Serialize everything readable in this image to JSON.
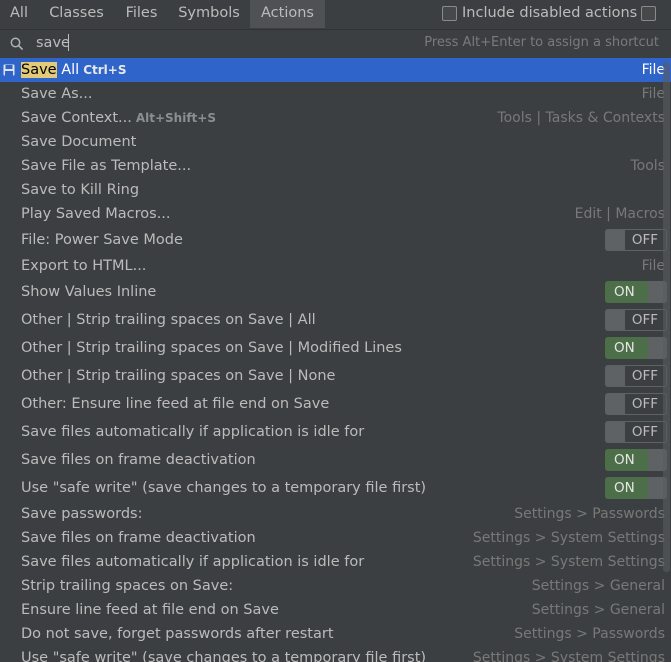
{
  "tabs": [
    {
      "label": "All",
      "active": false
    },
    {
      "label": "Classes",
      "active": false
    },
    {
      "label": "Files",
      "active": false
    },
    {
      "label": "Symbols",
      "active": false
    },
    {
      "label": "Actions",
      "active": true
    }
  ],
  "include_disabled": {
    "label": "Include disabled actions",
    "checked": false
  },
  "search": {
    "value": "save",
    "hint": "Press Alt+Enter to assign a shortcut"
  },
  "rows": [
    {
      "pre": "",
      "hl": "Save",
      "post": " All",
      "kbd": "Ctrl+S",
      "loc": "File",
      "selected": true,
      "icon": "save-icon"
    },
    {
      "pre": "Save As...",
      "loc": "File"
    },
    {
      "pre": "Save Context...",
      "kbd": "Alt+Shift+S",
      "loc": "Tools | Tasks & Contexts"
    },
    {
      "pre": "Save Document",
      "loc": ""
    },
    {
      "pre": "Save File as Template...",
      "loc": "Tools"
    },
    {
      "pre": "Save to Kill Ring",
      "loc": ""
    },
    {
      "pre": "Play Saved Macros...",
      "loc": "Edit | Macros"
    },
    {
      "pre": "File: Power Save Mode",
      "toggle": "OFF"
    },
    {
      "pre": "Export to HTML...",
      "loc": "File"
    },
    {
      "pre": "Show Values Inline",
      "toggle": "ON"
    },
    {
      "pre": "Other | Strip trailing spaces on Save | All",
      "toggle": "OFF"
    },
    {
      "pre": "Other | Strip trailing spaces on Save | Modified Lines",
      "toggle": "ON"
    },
    {
      "pre": "Other | Strip trailing spaces on Save | None",
      "toggle": "OFF"
    },
    {
      "pre": "Other: Ensure line feed at file end on Save",
      "toggle": "OFF"
    },
    {
      "pre": "Save files automatically if application is idle for",
      "toggle": "OFF"
    },
    {
      "pre": "Save files on frame deactivation",
      "toggle": "ON"
    },
    {
      "pre": "Use \"safe write\" (save changes to a temporary file first)",
      "toggle": "ON"
    },
    {
      "pre": "Save passwords:",
      "loc": "Settings > Passwords"
    },
    {
      "pre": "Save files on frame deactivation",
      "loc": "Settings > System Settings"
    },
    {
      "pre": "Save files automatically if application is idle for",
      "loc": "Settings > System Settings"
    },
    {
      "pre": "Strip trailing spaces on Save:",
      "loc": "Settings > General"
    },
    {
      "pre": "Ensure line feed at file end on Save",
      "loc": "Settings > General"
    },
    {
      "pre": "Do not save, forget passwords after restart",
      "loc": "Settings > Passwords"
    },
    {
      "pre": "Use \"safe write\" (save changes to a temporary file first)",
      "loc": "Settings > System Settings"
    }
  ],
  "colors": {
    "selection": "#2f65ca",
    "highlight": "#e2cb78",
    "toggle_on": "#4c6e48",
    "background": "#3c3f41"
  }
}
